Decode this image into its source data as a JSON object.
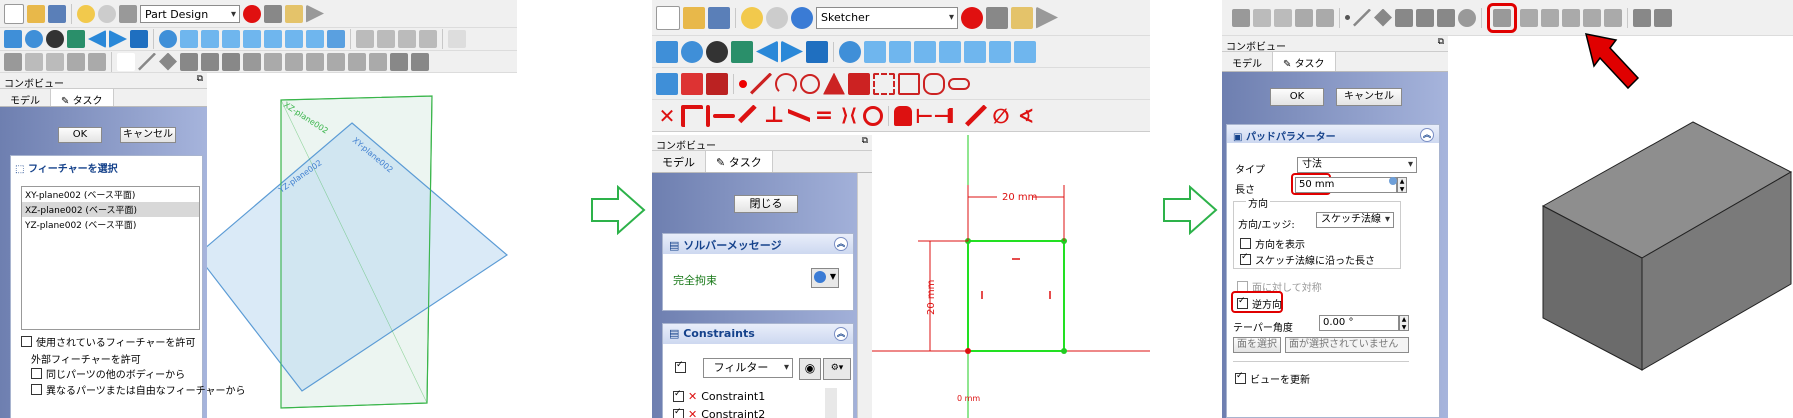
{
  "panel1": {
    "workbench": "Part Design",
    "combo_title": "コンボビュー",
    "tabs": [
      "モデル",
      "タスク"
    ],
    "ok": "OK",
    "cancel": "キャンセル",
    "feature_box_title": "フィーチャーを選択",
    "features": [
      "XY-plane002 (ベース平面)",
      "XZ-plane002 (ベース平面)",
      "YZ-plane002 (ベース平面)"
    ],
    "allow_used": "使用されているフィーチャーを許可",
    "external_group": "外部フィーチャーを許可",
    "ext_same_part": "同じパーツの他のボディーから",
    "ext_diff_part": "異なるパーツまたは自由なフィーチャーから",
    "plane_labels": [
      "XZ-plane002",
      "XY-plane002",
      "YZ-plane002"
    ]
  },
  "panel2": {
    "workbench": "Sketcher",
    "combo_title": "コンボビュー",
    "tabs": [
      "モデル",
      "タスク"
    ],
    "close": "閉じる",
    "solver_title": "ソルバーメッセージ",
    "solver_status": "完全拘束",
    "constraints_title": "Constraints",
    "filter": "フィルター",
    "constraint_items": [
      "Constraint1",
      "Constraint2"
    ],
    "dim_h": "20 mm",
    "dim_v": "20 mm",
    "origin_label": "0 mm"
  },
  "panel3": {
    "combo_title": "コンボビュー",
    "tabs": [
      "モデル",
      "タスク"
    ],
    "ok": "OK",
    "cancel": "キャンセル",
    "pad_title": "パッドパラメーター",
    "type_label": "タイプ",
    "type_value": "寸法",
    "length_label": "長さ",
    "length_value": "50 mm",
    "direction_group": "方向",
    "dir_edge_label": "方向/エッジ:",
    "dir_edge_value": "スケッチ法線",
    "show_direction": "方向を表示",
    "along_normal": "スケッチ法線に沿った長さ",
    "symmetric": "面に対して対称",
    "reversed": "逆方向",
    "taper_label": "テーパー角度",
    "taper_value": "0.00 °",
    "select_face": "面を選択",
    "no_face": "面が選択されていません",
    "update_view": "ビューを更新"
  },
  "colors": {
    "highlight_red": "#e00000",
    "sketch_green": "#22cc22",
    "plane_blue": "#7fb2e6",
    "plane_green": "#39b54a",
    "arrow_green": "#2db24a"
  }
}
